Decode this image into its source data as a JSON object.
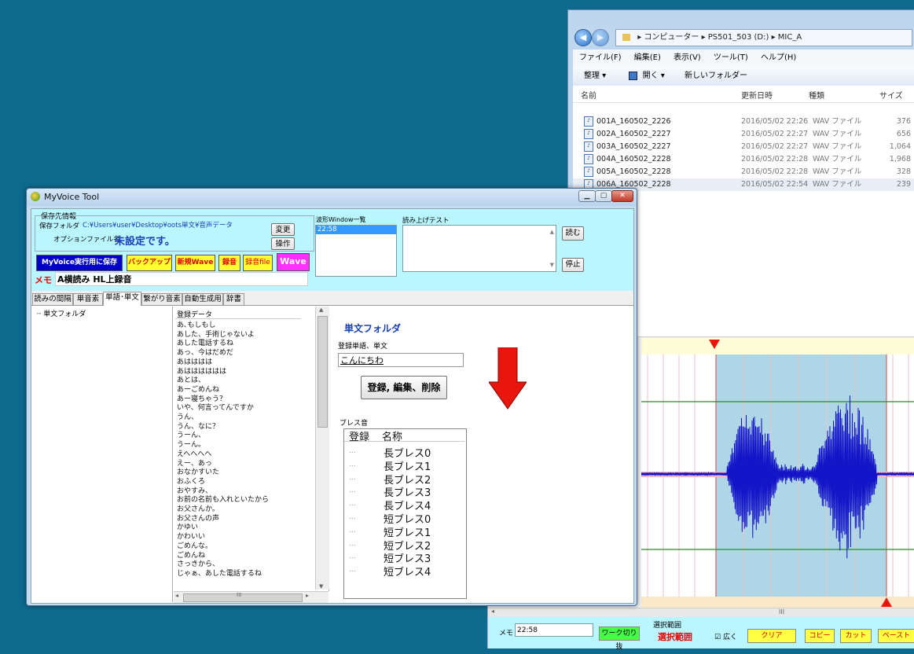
{
  "explorer": {
    "path": [
      "コンピューター",
      "PS501_503 (D:)",
      "MIC_A"
    ],
    "menu": [
      "ファイル(F)",
      "編集(E)",
      "表示(V)",
      "ツール(T)",
      "ヘルプ(H)"
    ],
    "commands": [
      "整理 ▾",
      "開く ▾",
      "新しいフォルダー"
    ],
    "columns": [
      "名前",
      "更新日時",
      "種類",
      "サイズ"
    ],
    "files": [
      {
        "name": "001A_160502_2226",
        "date": "2016/05/02 22:26",
        "type": "WAV ファイル",
        "size": "376"
      },
      {
        "name": "002A_160502_2227",
        "date": "2016/05/02 22:27",
        "type": "WAV ファイル",
        "size": "656"
      },
      {
        "name": "003A_160502_2227",
        "date": "2016/05/02 22:27",
        "type": "WAV ファイル",
        "size": "1,064"
      },
      {
        "name": "004A_160502_2228",
        "date": "2016/05/02 22:28",
        "type": "WAV ファイル",
        "size": "1,968"
      },
      {
        "name": "005A_160502_2228",
        "date": "2016/05/02 22:28",
        "type": "WAV ファイル",
        "size": "328"
      },
      {
        "name": "006A_160502_2228",
        "date": "2016/05/02 22:54",
        "type": "WAV ファイル",
        "size": "239"
      }
    ]
  },
  "wave": {
    "memo_label": "メモ",
    "memo_value": "22:58",
    "work_toggle": "ワーク切り抜",
    "range_group": "選択範囲",
    "range_label": "選択範囲",
    "wide_label": "広く",
    "clear": "クリア",
    "copy": "コピー",
    "cut": "カット",
    "paste": "ペースト",
    "scroll_mark": "III"
  },
  "main": {
    "title": "MyVoice Tool",
    "save_group": "保存先情報",
    "save_folder_label": "保存フォルダ",
    "save_folder_path": "C:¥Users¥user¥Desktop¥oots単文¥音声データ",
    "change": "変更",
    "option_label": "オプションファイル名",
    "option_value": "未設定です。",
    "operate": "操作",
    "btn_myvoice_save": "MyVoice実行用に保存",
    "btn_backup": "バックアップ",
    "btn_new_wave": "新規Wave",
    "btn_record": "録音",
    "btn_record_file": "録音file",
    "btn_wave": "Wave",
    "memo_label": "メモ",
    "memo_value": "A横読み HL上録音",
    "wavelist_label": "波形Window一覧",
    "wavelist_items": [
      "22:58"
    ],
    "readtest_label": "読み上げテスト",
    "read": "読む",
    "stop": "停止",
    "tabs": [
      "読みの間隔",
      "単音素",
      "単語･単文",
      "繋がり音素",
      "自動生成用",
      "辞書"
    ],
    "tree_root": "単文フォルダ",
    "list_header": "登録データ",
    "list_items": [
      "あ､もしもし",
      "あした、手術じゃないよ",
      "あした電話するね",
      "あっ、今はだめだ",
      "あはははは",
      "あはははははは",
      "あとは、",
      "あーごめんね",
      "あー寝ちゃう？",
      "いや、何言ってんですか",
      "うん、",
      "うん、なに？",
      "うーん、",
      "うーん。",
      "えへへへへ",
      "えー、あっ",
      "おなかすいた",
      "おふくろ",
      "おやすみ、",
      "お前の名前も入れといたから",
      "お父さんか。",
      "お父さんの声",
      "かゆい",
      "かわいい",
      "ごめんな。",
      "ごめんね",
      "さっきから、",
      "じゃぁ、あした電話するね"
    ],
    "hscroll_mark": "III",
    "folder_title": "単文フォルダ",
    "reg_label": "登録単語、単文",
    "reg_value": "こんにちわ",
    "reg_button": "登録, 編集、削除",
    "breath_label": "ブレス音",
    "breath_col_reg": "登録",
    "breath_col_name": "名称",
    "breath_dots": "...",
    "breath_items": [
      "長ブレス0",
      "長ブレス1",
      "長ブレス2",
      "長ブレス3",
      "長ブレス4",
      "短ブレス0",
      "短ブレス1",
      "短ブレス2",
      "短ブレス3",
      "短ブレス4"
    ]
  },
  "colors": {
    "desktop": "#0d6a8e",
    "cyan_panel": "#b9f6ff",
    "wave_blue": "#1414c8",
    "arrow_red": "#e8160c"
  }
}
